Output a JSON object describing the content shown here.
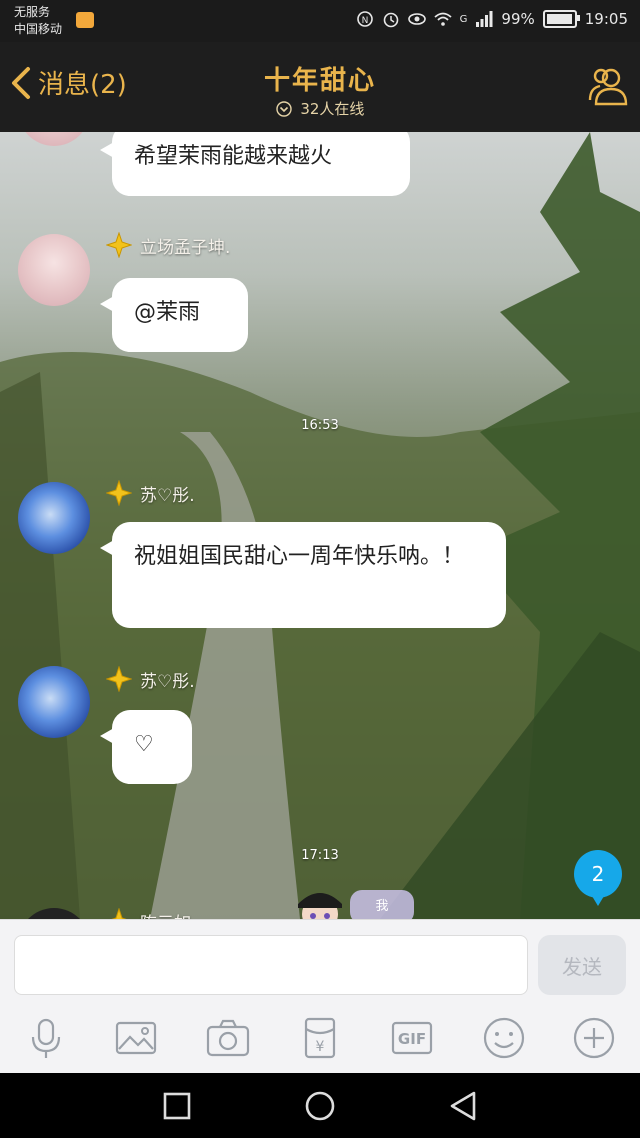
{
  "status_bar": {
    "carrier_line1": "无服务",
    "carrier_line2": "中国移动",
    "signal_label": "G",
    "battery": "99%",
    "battery_level": 0.99,
    "time": "19:05",
    "icons": [
      "nfc-icon",
      "alarm-icon",
      "eye-icon",
      "wifi-icon",
      "signal-icon",
      "battery-icon",
      "mail-icon"
    ]
  },
  "header": {
    "back_label": "消息(2)",
    "title": "十年甜心",
    "online_count": "32人在线"
  },
  "messages": [
    {
      "type": "text",
      "text": "希望茉雨能越来越火",
      "avatar": "pink"
    },
    {
      "type": "text",
      "nick": "立场孟子坤.",
      "text": "@茉雨",
      "avatar": "pink"
    },
    {
      "type": "time",
      "text": "16:53"
    },
    {
      "type": "text",
      "nick": "苏♡彤.",
      "text": "祝姐姐国民甜心一周年快乐呐。！",
      "avatar": "blue"
    },
    {
      "type": "text",
      "nick": "苏♡彤.",
      "text": "♡",
      "avatar": "blue"
    },
    {
      "type": "time",
      "text": "17:13"
    }
  ],
  "partial_nick": "陈元如",
  "sticker_label": "我",
  "unread_count": "2",
  "input": {
    "placeholder": "",
    "value": "",
    "send_label": "发送"
  },
  "toolbar": {
    "items": [
      "mic-icon",
      "image-icon",
      "camera-icon",
      "red-packet-icon",
      "gif-icon",
      "emoji-icon",
      "plus-icon"
    ],
    "gif_label": "GIF",
    "red_packet_symbol": "¥"
  },
  "colors": {
    "header_bg": "#1e1e1e",
    "accent_gold": "#e9b44c",
    "unread_blue": "#16a8e9"
  }
}
